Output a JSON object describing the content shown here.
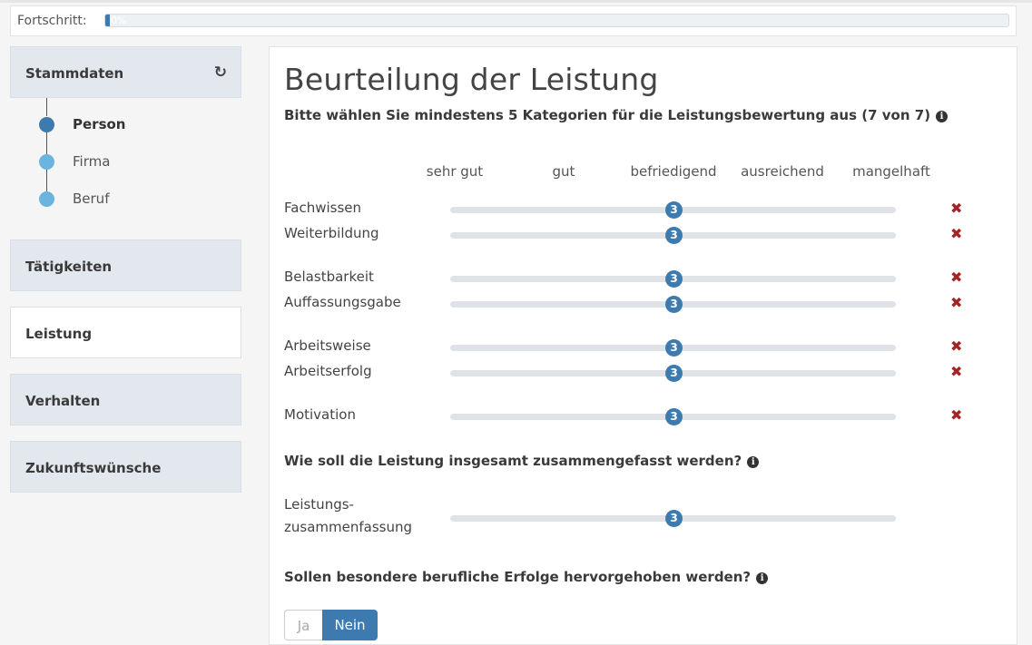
{
  "progress": {
    "label": "Fortschritt:",
    "value_text": "0%",
    "value": 0
  },
  "sidebar": {
    "sections": [
      {
        "label": "Stammdaten",
        "icon": "refresh-icon"
      },
      {
        "label": "Tätigkeiten"
      },
      {
        "label": "Leistung",
        "active": true
      },
      {
        "label": "Verhalten"
      },
      {
        "label": "Zukunftswünsche"
      }
    ],
    "steps": [
      {
        "label": "Person",
        "current": true
      },
      {
        "label": "Firma"
      },
      {
        "label": "Beruf"
      }
    ]
  },
  "main": {
    "title": "Beurteilung der Leistung",
    "categories_question": "Bitte wählen Sie mindestens 5 Kategorien für die Leistungsbewertung aus (7 von 7)",
    "scale": [
      "sehr gut",
      "gut",
      "befriedigend",
      "ausreichend",
      "mangelhaft"
    ],
    "ratings": [
      {
        "label": "Fachwissen",
        "value": "3"
      },
      {
        "label": "Weiterbildung",
        "value": "3"
      },
      {
        "label": "Belastbarkeit",
        "value": "3"
      },
      {
        "label": "Auffassungsgabe",
        "value": "3"
      },
      {
        "label": "Arbeitsweise",
        "value": "3"
      },
      {
        "label": "Arbeitserfolg",
        "value": "3"
      },
      {
        "label": "Motivation",
        "value": "3"
      }
    ],
    "summary_question": "Wie soll die Leistung insgesamt zusammengefasst werden?",
    "summary": {
      "label_line1": "Leistungs-",
      "label_line2": "zusammenfassung",
      "value": "3"
    },
    "success_question": "Sollen besondere berufliche Erfolge hervorgehoben werden?",
    "toggle": {
      "yes": "Ja",
      "no": "Nein",
      "selected": "Nein"
    }
  },
  "colors": {
    "accent": "#3d7ab0",
    "step_dot": "#6ab4e0",
    "remove": "#a32424",
    "nav_bg": "#e3e8ef"
  }
}
